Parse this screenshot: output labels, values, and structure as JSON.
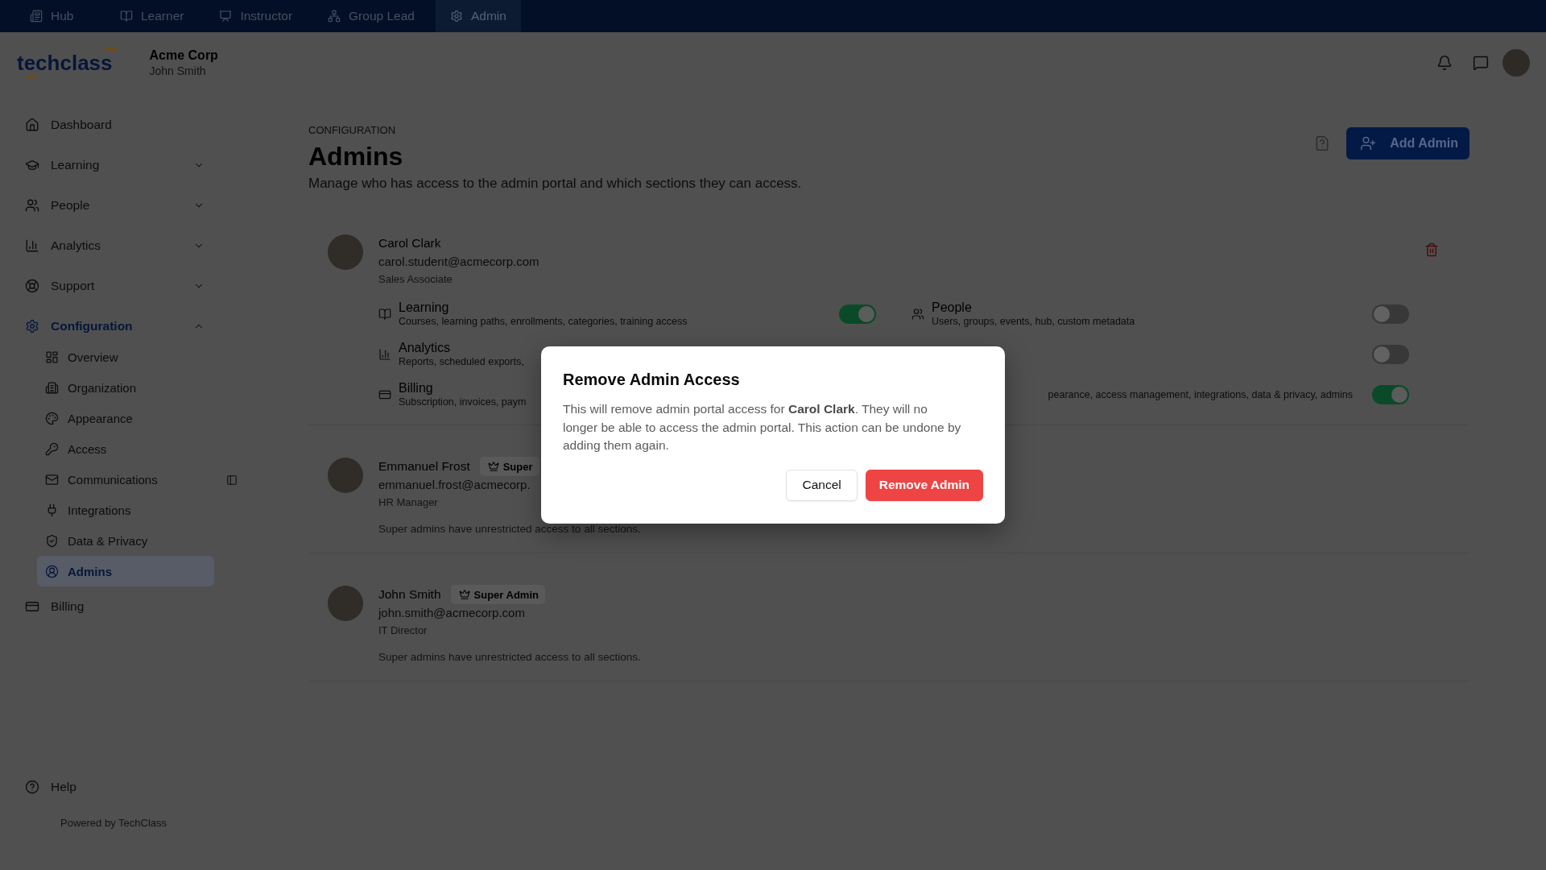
{
  "top_nav": {
    "tabs": [
      {
        "label": "Hub",
        "selected": false
      },
      {
        "label": "Learner",
        "selected": false
      },
      {
        "label": "Instructor",
        "selected": false
      },
      {
        "label": "Group Lead",
        "selected": false
      },
      {
        "label": "Admin",
        "selected": true
      }
    ]
  },
  "header": {
    "logo": "techclass",
    "organization": "Acme Corp",
    "user": "John Smith"
  },
  "sidebar": {
    "items": [
      {
        "label": "Dashboard",
        "selected": false
      },
      {
        "label": "Learning",
        "selected": false,
        "expanded": false
      },
      {
        "label": "People",
        "selected": false,
        "expanded": false
      },
      {
        "label": "Analytics",
        "selected": false,
        "expanded": false
      },
      {
        "label": "Support",
        "selected": false,
        "expanded": false
      },
      {
        "label": "Configuration",
        "selected": true,
        "expanded": true,
        "children": [
          {
            "label": "Overview",
            "selected": false
          },
          {
            "label": "Organization",
            "selected": false
          },
          {
            "label": "Appearance",
            "selected": false
          },
          {
            "label": "Access",
            "selected": false
          },
          {
            "label": "Communications",
            "selected": false
          },
          {
            "label": "Integrations",
            "selected": false
          },
          {
            "label": "Data & Privacy",
            "selected": false
          },
          {
            "label": "Admins",
            "selected": true
          }
        ]
      },
      {
        "label": "Billing",
        "selected": false
      }
    ],
    "help": "Help",
    "powered_by": "Powered by TechClass"
  },
  "page": {
    "breadcrumb": "CONFIGURATION",
    "title": "Admins",
    "description": "Manage who has access to the admin portal and which sections they can access.",
    "add_button": "Add Admin"
  },
  "admins": [
    {
      "name": "Carol Clark",
      "email": "carol.student@acmecorp.com",
      "role": "Sales Associate",
      "removable": true,
      "permissions": [
        {
          "title": "Learning",
          "description": "Courses, learning paths, enrollments, categories, training access",
          "on": true
        },
        {
          "title": "People",
          "description": "Users, groups, events, hub, custom metadata",
          "on": false
        },
        {
          "title": "Analytics",
          "description": "Reports, scheduled exports,"
        },
        {
          "on": false
        },
        {
          "title": "Billing",
          "description": "Subscription, invoices, paym"
        },
        {
          "description": "pearance, access management, integrations, data & privacy, admins",
          "on": true
        }
      ]
    },
    {
      "name": "Emmanuel Frost",
      "badge": "Super",
      "email": "emmanuel.frost@acmecorp.",
      "role": "HR Manager",
      "removable": false,
      "note": "Super admins have unrestricted access to all sections."
    },
    {
      "name": "John Smith",
      "badge": "Super Admin",
      "email": "john.smith@acmecorp.com",
      "role": "IT Director",
      "removable": false,
      "note": "Super admins have unrestricted access to all sections."
    }
  ],
  "dialog": {
    "title": "Remove Admin Access",
    "message": "This will remove admin portal access for **Carol Clark**. They will no longer be able to access the admin portal. This action can be undone by adding them again.",
    "buttons": [
      {
        "label": "Cancel",
        "kind": "secondary"
      },
      {
        "label": "Remove Admin",
        "kind": "danger"
      }
    ]
  }
}
